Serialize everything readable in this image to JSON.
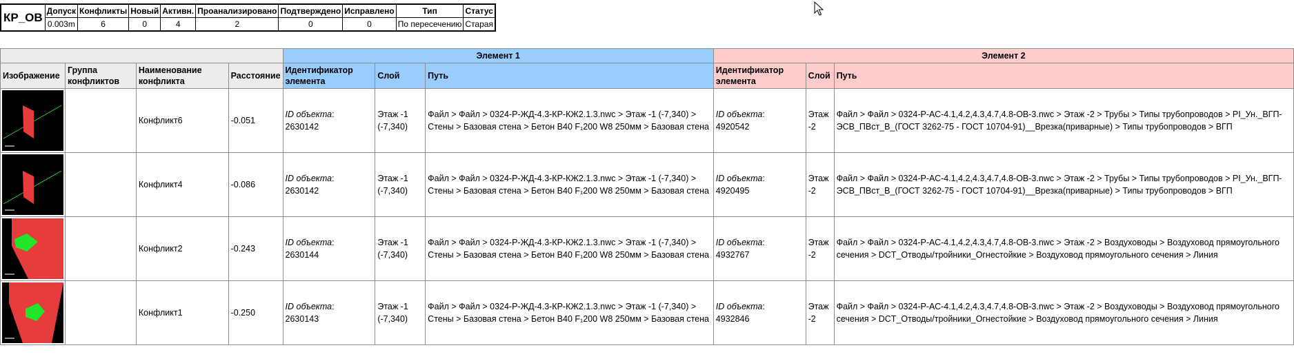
{
  "summary": {
    "test_name": "КР_ОВ",
    "headers": [
      "Допуск",
      "Конфликты",
      "Новый",
      "Активн.",
      "Проанализировано",
      "Подтверждено",
      "Исправлено",
      "Тип",
      "Статус"
    ],
    "values": [
      "0.003m",
      "6",
      "0",
      "4",
      "2",
      "0",
      "0",
      "По пересечению",
      "Старая"
    ]
  },
  "results": {
    "group_headers": {
      "element1": "Элемент 1",
      "element2": "Элемент 2"
    },
    "columns": {
      "image": "Изображение",
      "group": "Группа конфликтов",
      "name": "Наименование конфликта",
      "distance": "Расстояние",
      "e1_id": "Идентификатор элемента",
      "e1_layer": "Слой",
      "e1_path": "Путь",
      "e2_id": "Идентификатор элемента",
      "e2_layer": "Слой",
      "e2_path": "Путь"
    },
    "id_label": "ID объекта",
    "rows": [
      {
        "image_type": "wall-pipe-thumbnail",
        "group": "",
        "name": "Конфликт6",
        "distance": "-0.051",
        "e1_id": "2630142",
        "e1_layer": "Этаж -1 (-7,340)",
        "e1_path": "Файл > Файл > 0324-Р-ЖД-4.3-КР-КЖ2.1.3.nwc > Этаж -1 (-7,340) > Стены > Базовая стена > Бетон В40 F₁200 W8 250мм > Базовая стена",
        "e2_id": "4920542",
        "e2_layer": "Этаж -2",
        "e2_path": "Файл > Файл > 0324-Р-АС-4.1,4.2,4.3,4.7,4.8-ОВ-3.nwc > Этаж -2 > Трубы > Типы трубопроводов > PI_Ун._ВГП-ЭСВ_ПВст_В_(ГОСТ 3262-75 - ГОСТ 10704-91)__Врезка(приварные) > Типы трубопроводов > ВГП"
      },
      {
        "image_type": "wall-pipe-thumbnail",
        "group": "",
        "name": "Конфликт4",
        "distance": "-0.086",
        "e1_id": "2630142",
        "e1_layer": "Этаж -1 (-7,340)",
        "e1_path": "Файл > Файл > 0324-Р-ЖД-4.3-КР-КЖ2.1.3.nwc > Этаж -1 (-7,340) > Стены > Базовая стена > Бетон В40 F₁200 W8 250мм > Базовая стена",
        "e2_id": "4920495",
        "e2_layer": "Этаж -2",
        "e2_path": "Файл > Файл > 0324-Р-АС-4.1,4.2,4.3,4.7,4.8-ОВ-3.nwc > Этаж -2 > Трубы > Типы трубопроводов > PI_Ун._ВГП-ЭСВ_ПВст_В_(ГОСТ 3262-75 - ГОСТ 10704-91)__Врезка(приварные) > Типы трубопроводов > ВГП"
      },
      {
        "image_type": "wall-duct-thumbnail",
        "group": "",
        "name": "Конфликт2",
        "distance": "-0.243",
        "e1_id": "2630144",
        "e1_layer": "Этаж -1 (-7,340)",
        "e1_path": "Файл > Файл > 0324-Р-ЖД-4.3-КР-КЖ2.1.3.nwc > Этаж -1 (-7,340) > Стены > Базовая стена > Бетон В40 F₁200 W8 250мм > Базовая стена",
        "e2_id": "4932767",
        "e2_layer": "Этаж -2",
        "e2_path": "Файл > Файл > 0324-Р-АС-4.1,4.2,4.3,4.7,4.8-ОВ-3.nwc > Этаж -2 > Воздуховоды > Воздуховод прямоугольного сечения > DCT_Отводы/тройники_Огнестойкие > Воздуховод прямоугольного сечения > Линия"
      },
      {
        "image_type": "wall-duct-thumbnail",
        "group": "",
        "name": "Конфликт1",
        "distance": "-0.250",
        "e1_id": "2630143",
        "e1_layer": "Этаж -1 (-7,340)",
        "e1_path": "Файл > Файл > 0324-Р-ЖД-4.3-КР-КЖ2.1.3.nwc > Этаж -1 (-7,340) > Стены > Базовая стена > Бетон В40 F₁200 W8 250мм > Базовая стена",
        "e2_id": "4932846",
        "e2_layer": "Этаж -2",
        "e2_path": "Файл > Файл > 0324-Р-АС-4.1,4.2,4.3,4.7,4.8-ОВ-3.nwc > Этаж -2 > Воздуховоды > Воздуховод прямоугольного сечения > DCT_Отводы/тройники_Огнестойкие > Воздуховод прямоугольного сечения > Линия"
      }
    ]
  },
  "colors": {
    "element1_header": "#99ccff",
    "element2_header": "#ffcccc",
    "wall_red": "#e63c3c",
    "clash_green": "#22e62a",
    "pipe_green": "#2bd42b"
  }
}
